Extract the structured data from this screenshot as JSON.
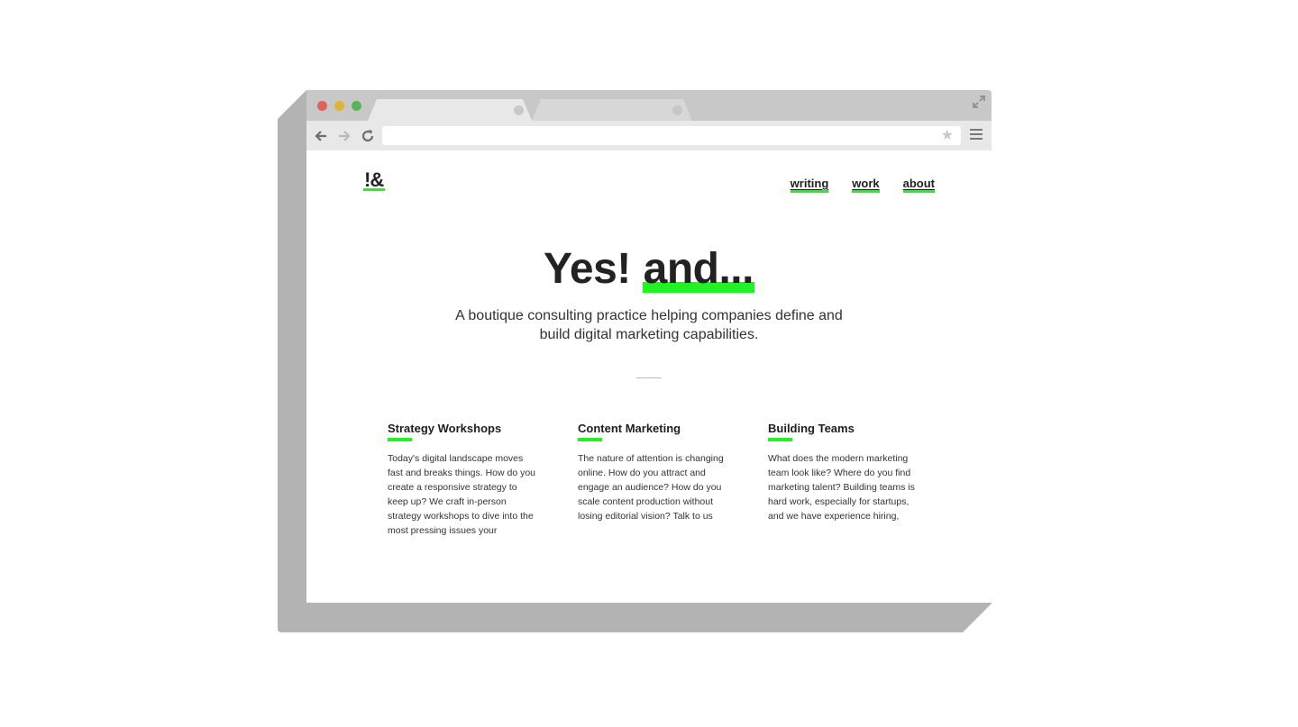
{
  "browser": {
    "tabs": [
      {
        "state": "active"
      },
      {
        "state": "inactive"
      }
    ],
    "address_value": "",
    "icons": [
      "back-arrow-icon",
      "forward-arrow-icon",
      "reload-icon",
      "star-icon",
      "menu-icon",
      "expand-icon"
    ]
  },
  "site": {
    "logo": "!&",
    "nav": [
      "writing",
      "work",
      "about"
    ],
    "hero": {
      "title_plain": "Yes!",
      "title_accent": "and...",
      "subtitle": "A boutique consulting practice helping companies define and build digital marketing capabilities."
    },
    "services": [
      {
        "title": "Strategy Workshops",
        "body": "Today's digital landscape moves fast and breaks things. How do you create a responsive strategy to keep up? We craft in-person strategy workshops to dive into the most pressing issues your"
      },
      {
        "title": "Content Marketing",
        "body": "The nature of attention is changing online. How do you attract and engage an audience? How do you scale content production without losing editorial vision? Talk to us"
      },
      {
        "title": "Building Teams",
        "body": "What does the modern marketing team look like? Where do you find marketing talent? Building teams is hard work, especially for startups, and we have experience hiring,"
      }
    ]
  },
  "colors": {
    "accent": "#22f222",
    "text": "#222222",
    "chrome": "#c8c8c8"
  }
}
